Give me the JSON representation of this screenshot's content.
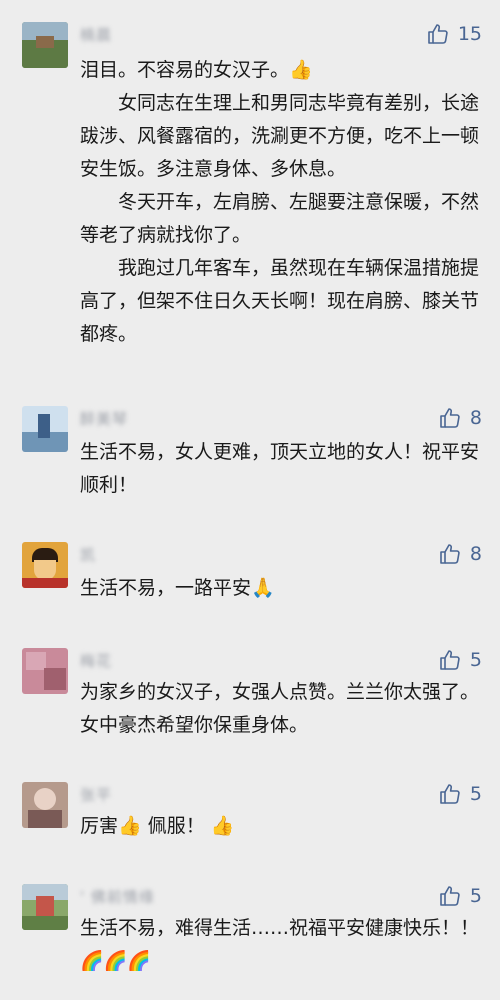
{
  "comments": [
    {
      "name": "楠晨",
      "likes": "15",
      "paragraphs": [
        "泪目。不容易的女汉子。👍",
        "女同志在生理上和男同志毕竟有差别，长途跋涉、风餐露宿的，洗涮更不方便，吃不上一顿安生饭。多注意身体、多休息。",
        "冬天开车，左肩膀、左腿要注意保暖，不然等老了病就找你了。",
        "我跑过几年客车，虽然现在车辆保温措施提高了，但架不住日久天长啊！现在肩膀、膝关节都疼。"
      ]
    },
    {
      "name": "醉美琴",
      "likes": "8",
      "paragraphs": [
        "生活不易，女人更难，顶天立地的女人！祝平安顺利！"
      ]
    },
    {
      "name": "凯",
      "likes": "8",
      "paragraphs": [
        "生活不易，一路平安🙏"
      ]
    },
    {
      "name": "梅花",
      "likes": "5",
      "paragraphs": [
        "为家乡的女汉子，女强人点赞。兰兰你太强了。女中豪杰希望你保重身体。"
      ]
    },
    {
      "name": "张平",
      "likes": "5",
      "paragraphs": [
        "厉害👍 佩服！ 👍"
      ]
    },
    {
      "name": "'  佛前情缘",
      "likes": "5",
      "paragraphs": [
        "生活不易，难得生活……祝福平安健康快乐！！🌈🌈🌈"
      ]
    }
  ],
  "icons": {
    "like": "thumbs-up-icon"
  },
  "colors": {
    "accent": "#4a6693",
    "text": "#1a1a1a",
    "name": "#9ea2aa",
    "background": "#ededed"
  }
}
